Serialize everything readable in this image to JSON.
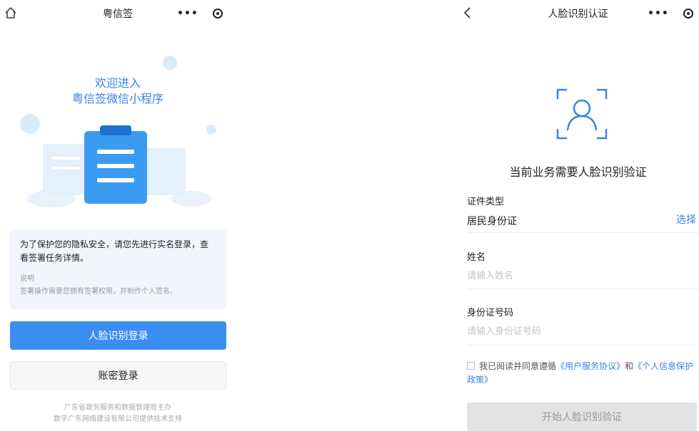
{
  "left": {
    "nav": {
      "title": "粤信签",
      "left_icon": "home-icon",
      "more": "•••",
      "close_icon": "target-icon"
    },
    "welcome_line1": "欢迎进入",
    "welcome_line2": "粤信签微信小程序",
    "tip": {
      "main": "为了保护您的隐私安全，请您先进行实名登录，查看签署任务详情。",
      "sub_title": "说明",
      "sub_text": "签署操作需要您拥有签署权限，并制作个人签名。"
    },
    "btn_face_login": "人脸识别登录",
    "btn_password_login": "账密登录",
    "footer_line1": "广东省政务服务和数据管理局主办",
    "footer_line2": "数字广东网络建设有限公司提供技术支持"
  },
  "right": {
    "nav": {
      "title": "人脸识别认证",
      "left_icon": "back-chevron-icon",
      "more": "•••",
      "close_icon": "target-icon"
    },
    "heading": "当前业务需要人脸识别验证",
    "id_type_label": "证件类型",
    "id_type_value": "居民身份证",
    "select": "选择",
    "name_label": "姓名",
    "name_placeholder": "请输入姓名",
    "id_no_label": "身份证号码",
    "id_no_placeholder": "请输入身份证号码",
    "agree_prefix": "我已阅读并同意遵循",
    "agree_link1": "《用户服务协议》",
    "agree_and": "和",
    "agree_link2": "《个人信息保护政策》",
    "btn_start": "开始人脸识别验证"
  },
  "colors": {
    "primary": "#3a8ef0",
    "link": "#3a84e3",
    "card_bg": "#f2f6fc",
    "disabled_btn": "#e3e3e3"
  }
}
